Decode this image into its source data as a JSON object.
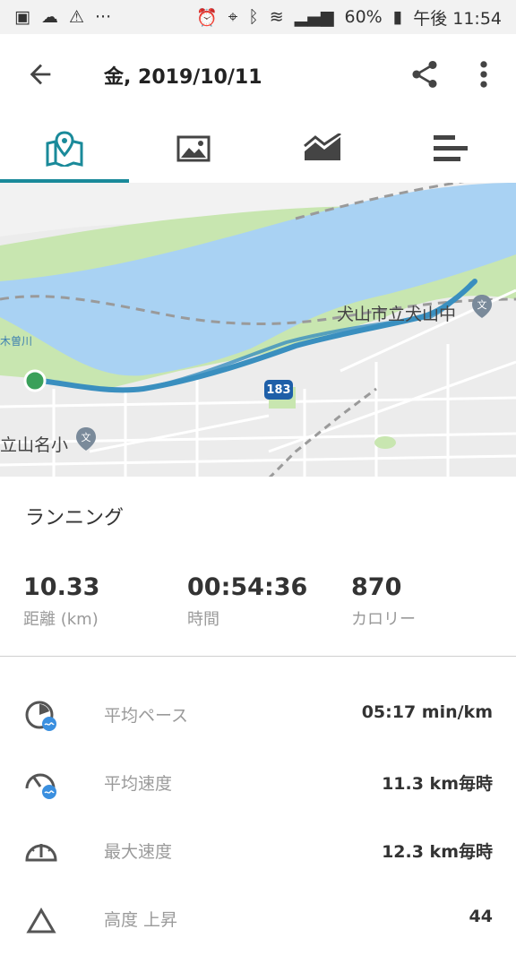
{
  "status_bar": {
    "battery": "60%",
    "time": "午後 11:54",
    "icons": [
      "image-icon",
      "cloud-icon",
      "warning-icon",
      "more-dots-icon",
      "alarm-icon",
      "location-icon",
      "bluetooth-icon",
      "clock-icon",
      "volte-icon",
      "wifi-icon",
      "signal-icon",
      "battery-icon"
    ]
  },
  "header": {
    "title": "金, 2019/10/11"
  },
  "tabs": [
    {
      "name": "map",
      "icon": "map-icon",
      "active": true
    },
    {
      "name": "photo",
      "icon": "photo-icon",
      "active": false
    },
    {
      "name": "chart",
      "icon": "chart-icon",
      "active": false
    },
    {
      "name": "stats",
      "icon": "bars-icon",
      "active": false
    }
  ],
  "map": {
    "labels": {
      "school_right": "犬山市立犬山中",
      "school_left": "立山名小",
      "river": "木曽川",
      "route_number": "183"
    },
    "colors": {
      "water": "#a9d2f3",
      "park": "#c8e6b0",
      "route": "#3a8fbf",
      "start": "#3aa05a"
    }
  },
  "activity": {
    "type": "ランニング"
  },
  "stats": [
    {
      "value": "10.33",
      "label": "距離 (km)"
    },
    {
      "value": "00:54:36",
      "label": "時間"
    },
    {
      "value": "870",
      "label": "カロリー"
    }
  ],
  "details": [
    {
      "icon": "pace-icon",
      "name": "平均ペース",
      "value": "05:17 min/km"
    },
    {
      "icon": "avg-speed-icon",
      "name": "平均速度",
      "value": "11.3 km毎時"
    },
    {
      "icon": "max-speed-icon",
      "name": "最大速度",
      "value": "12.3 km毎時"
    },
    {
      "icon": "elevation-icon",
      "name": "高度 上昇",
      "value": "44"
    }
  ]
}
